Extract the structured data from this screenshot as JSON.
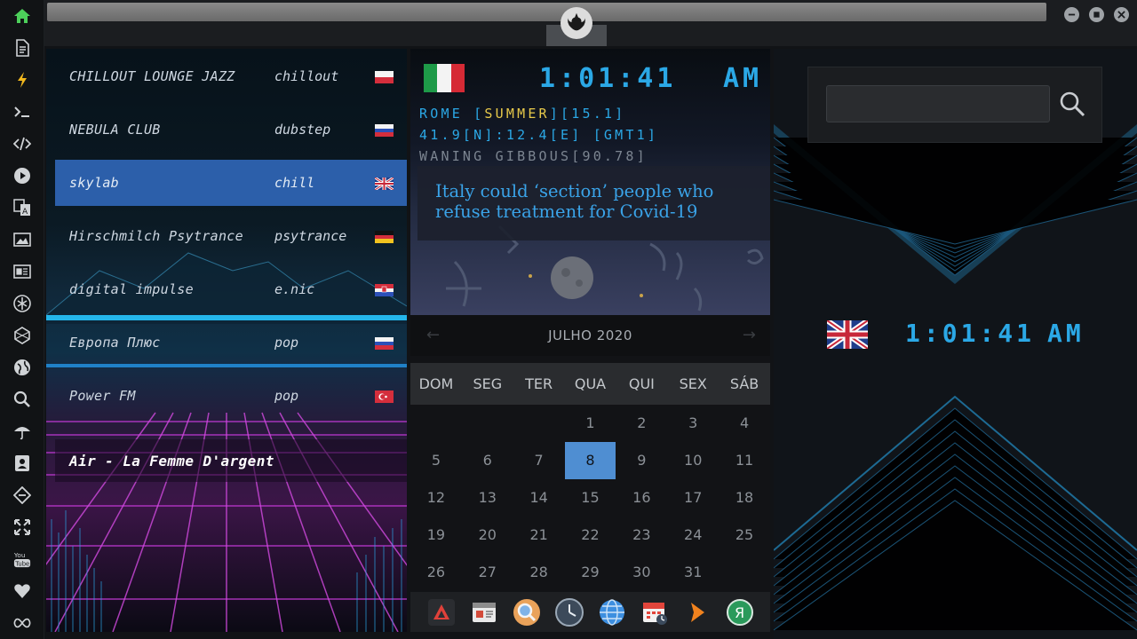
{
  "sidebar": {
    "icons": [
      "home-icon",
      "document-icon",
      "bolt-icon",
      "terminal-icon",
      "code-icon",
      "play-icon",
      "translate-icon",
      "image-icon",
      "news-icon",
      "rebel-icon",
      "game-icon",
      "globe-icon",
      "search-icon",
      "umbrella-icon",
      "contact-icon",
      "tag-icon",
      "expand-icon",
      "youtube-icon",
      "heart-icon",
      "infinity-icon"
    ],
    "youtube_label": "You Tube"
  },
  "radio": {
    "stations": [
      {
        "name": "CHILLOUT LOUNGE JAZZ",
        "genre": "chillout",
        "flag": "poland"
      },
      {
        "name": "NEBULA CLUB",
        "genre": "dubstep",
        "flag": "russia"
      },
      {
        "name": "skylab",
        "genre": "chill",
        "flag": "uk"
      },
      {
        "name": "Hirschmilch Psytrance",
        "genre": "psytrance",
        "flag": "germany"
      },
      {
        "name": "digital impulse",
        "genre": "e.nic",
        "flag": "croatia"
      },
      {
        "name": "Европа Плюс",
        "genre": "pop",
        "flag": "russia"
      },
      {
        "name": "Power FM",
        "genre": "pop",
        "flag": "turkey"
      }
    ],
    "active_index": 2,
    "now_playing": "Air - La Femme D'argent"
  },
  "clock": {
    "time": "1:01:41",
    "ampm": "AM",
    "flag": "italy",
    "location_prefix": "ROME [",
    "location_season": "SUMMER",
    "location_suffix": "][15.1]",
    "coords": "41.9[N]:12.4[E] [GMT1]",
    "moon": "WANING GIBBOUS[90.78]"
  },
  "news": {
    "headline": "Italy could ‘section’ people who refuse treatment for Covid-19"
  },
  "calendar": {
    "month_label": "JULHO 2020",
    "weekdays": [
      "DOM",
      "SEG",
      "TER",
      "QUA",
      "QUI",
      "SEX",
      "SÁB"
    ],
    "first_weekday": 3,
    "days_in_month": 31,
    "today": 8
  },
  "dock": {
    "apps": [
      "anydesk-icon",
      "calendar-news-icon",
      "search-app-icon",
      "clock-app-icon",
      "globe-app-icon",
      "calendar-app-icon",
      "arrow-app-icon",
      "yandex-icon"
    ]
  },
  "right": {
    "search_placeholder": "",
    "time": "1:01:41",
    "ampm": "AM",
    "flag": "uk"
  },
  "colors": {
    "accent": "#2ba8e6",
    "active_station": "#2c5faa",
    "today": "#4f8ed2",
    "highlight": "#e7c94a"
  }
}
